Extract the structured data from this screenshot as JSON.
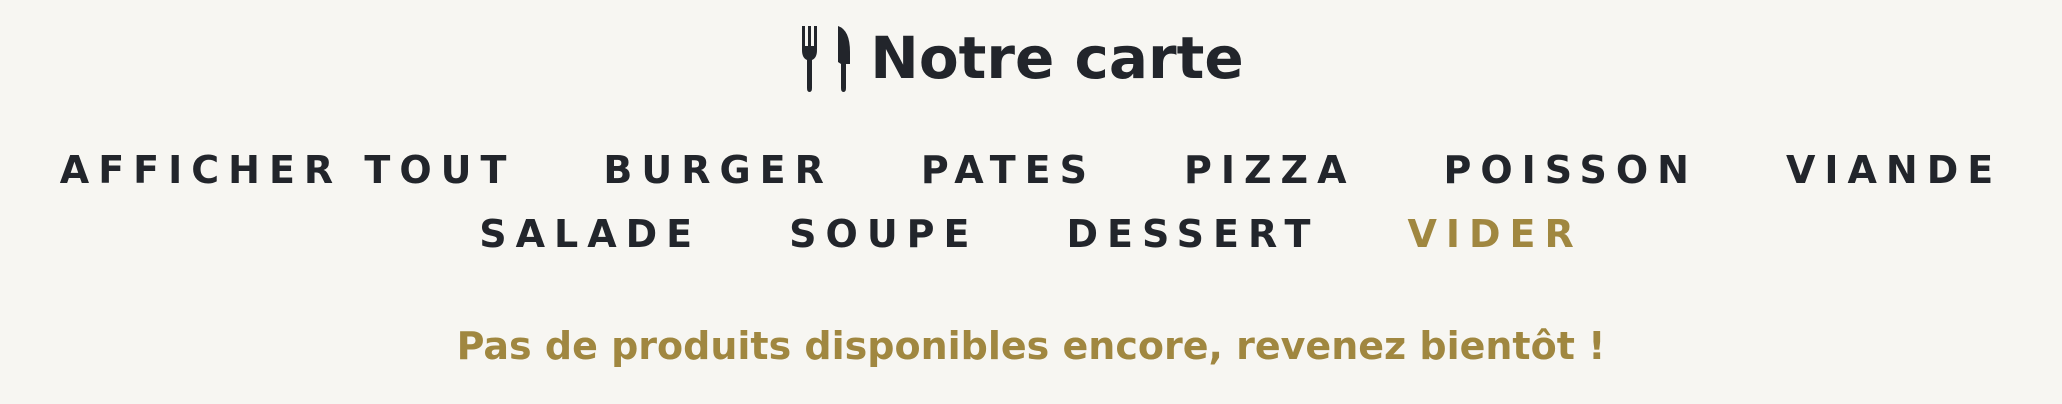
{
  "header": {
    "icon": "utensils-icon",
    "title": "Notre carte"
  },
  "filters": {
    "row1": [
      {
        "label": "AFFICHER TOUT",
        "name": "filter-all"
      },
      {
        "label": "BURGER",
        "name": "filter-burger"
      },
      {
        "label": "PATES",
        "name": "filter-pates"
      },
      {
        "label": "PIZZA",
        "name": "filter-pizza"
      },
      {
        "label": "POISSON",
        "name": "filter-poisson"
      },
      {
        "label": "VIANDE",
        "name": "filter-viande"
      }
    ],
    "row2": [
      {
        "label": "SALADE",
        "name": "filter-salade"
      },
      {
        "label": "SOUPE",
        "name": "filter-soupe"
      },
      {
        "label": "DESSERT",
        "name": "filter-dessert"
      },
      {
        "label": "VIDER",
        "name": "filter-clear"
      }
    ]
  },
  "message": "Pas de produits disponibles encore, revenez bientôt !",
  "colors": {
    "background": "#f7f6f2",
    "text": "#22252b",
    "accent": "#a08740"
  }
}
